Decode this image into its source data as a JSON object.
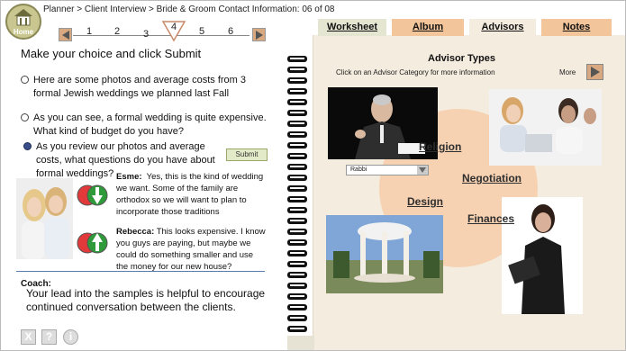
{
  "header": {
    "home_label": "Home",
    "breadcrumb": "Planner > Client Interview >  Bride & Groom Contact Information: 06 of 08",
    "pages": [
      "1",
      "2",
      "3",
      "4",
      "5",
      "6"
    ],
    "current_page": "4"
  },
  "question": {
    "instruction": "Make your choice and click Submit",
    "options": [
      {
        "line1": "Here are some photos and average costs from 3",
        "line2": "formal Jewish weddings we planned last Fall",
        "selected": false
      },
      {
        "line1": "As you can see, a formal wedding is quite expensive.",
        "line2": "What kind of budget do you have?",
        "selected": false
      },
      {
        "line1": "As you review our photos and average",
        "line2": "costs, what questions do you have about",
        "line3": "formal weddings?",
        "selected": true
      }
    ],
    "submit_label": "Submit"
  },
  "responses": [
    {
      "name": "Esme:",
      "lines": [
        "Yes, this is the kind of wedding",
        "we want.  Some of the family are",
        "orthodox so we will want to plan to",
        "incorporate those traditions"
      ],
      "status": "down"
    },
    {
      "name": "Rebecca:",
      "lines": [
        "This looks expensive. I know",
        "you guys are paying, but maybe we",
        "could do something smaller and use",
        "the money for our new house?"
      ],
      "status": "up"
    }
  ],
  "coach": {
    "label": "Coach:",
    "text": "Your lead into the samples is helpful to encourage continued conversation between the clients."
  },
  "bottom_icons": [
    "X",
    "?",
    "i"
  ],
  "tabs": [
    "Worksheet",
    "Album",
    "Advisors",
    "Notes"
  ],
  "advisors": {
    "title": "Advisor Types",
    "subtitle": "Click on an Advisor Category for more information",
    "more_label": "More",
    "categories": [
      "Religion",
      "Negotiation",
      "Design",
      "Finances"
    ],
    "rabbi_select": "Rabbi"
  },
  "colors": {
    "tab_active": "#f4ecde",
    "tab_inactive": "#f3c59a",
    "circle": "#f7d2b2",
    "home_button": "#c9c78f"
  }
}
